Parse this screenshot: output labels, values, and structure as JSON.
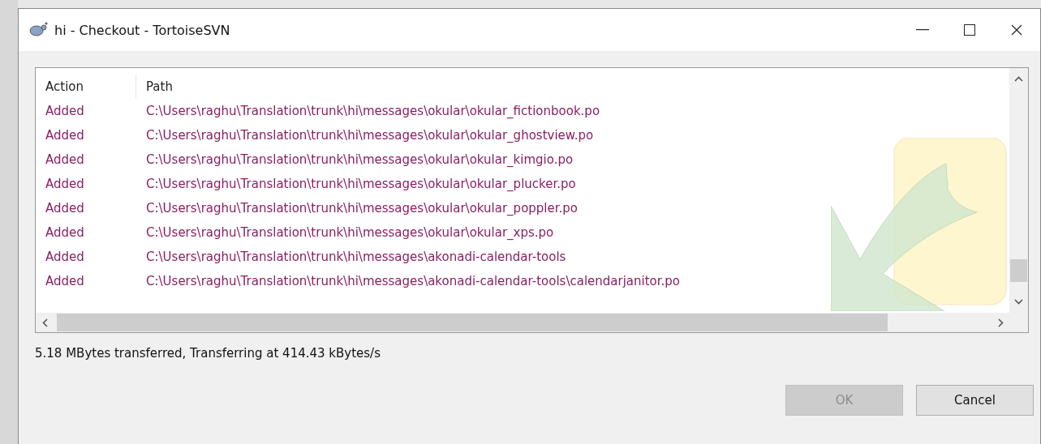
{
  "window": {
    "title": "hi - Checkout - TortoiseSVN"
  },
  "table": {
    "columns": [
      "Action",
      "Path"
    ],
    "rows": [
      {
        "action": "Added",
        "path": "C:\\Users\\raghu\\Translation\\trunk\\hi\\messages\\okular\\okular_fictionbook.po"
      },
      {
        "action": "Added",
        "path": "C:\\Users\\raghu\\Translation\\trunk\\hi\\messages\\okular\\okular_ghostview.po"
      },
      {
        "action": "Added",
        "path": "C:\\Users\\raghu\\Translation\\trunk\\hi\\messages\\okular\\okular_kimgio.po"
      },
      {
        "action": "Added",
        "path": "C:\\Users\\raghu\\Translation\\trunk\\hi\\messages\\okular\\okular_plucker.po"
      },
      {
        "action": "Added",
        "path": "C:\\Users\\raghu\\Translation\\trunk\\hi\\messages\\okular\\okular_poppler.po"
      },
      {
        "action": "Added",
        "path": "C:\\Users\\raghu\\Translation\\trunk\\hi\\messages\\okular\\okular_xps.po"
      },
      {
        "action": "Added",
        "path": "C:\\Users\\raghu\\Translation\\trunk\\hi\\messages\\akonadi-calendar-tools"
      },
      {
        "action": "Added",
        "path": "C:\\Users\\raghu\\Translation\\trunk\\hi\\messages\\akonadi-calendar-tools\\calendarjanitor.po"
      }
    ]
  },
  "status_bar": "5.18 MBytes transferred, Transferring at 414.43 kBytes/s",
  "buttons": [
    {
      "label": "OK",
      "disabled": true
    },
    {
      "label": "Cancel",
      "disabled": false
    }
  ]
}
